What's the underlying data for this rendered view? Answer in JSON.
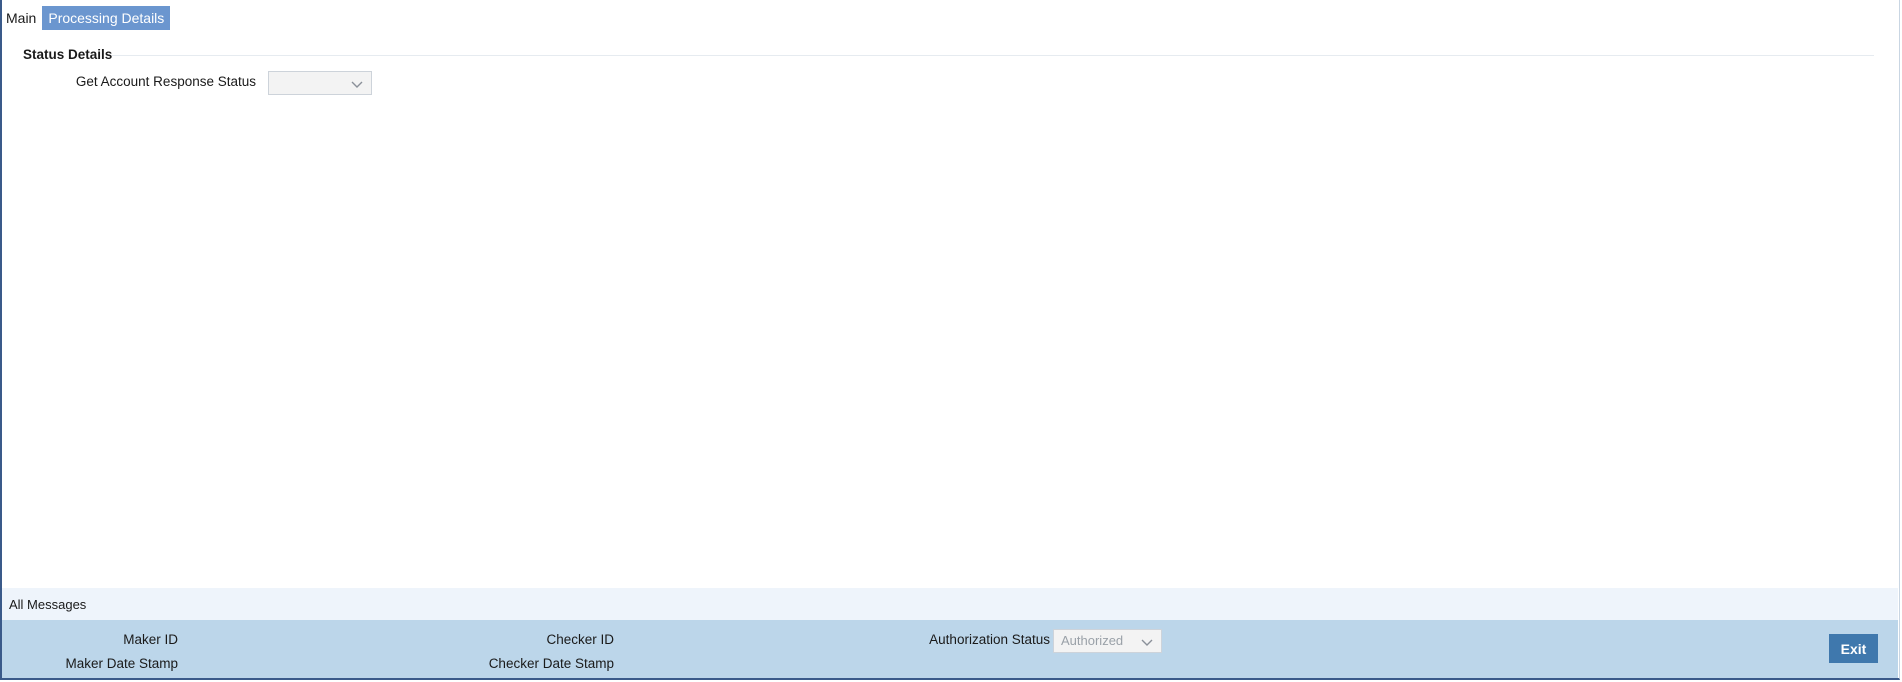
{
  "tabs": [
    {
      "label": "Main",
      "active": false
    },
    {
      "label": "Processing Details",
      "active": true
    }
  ],
  "status_details": {
    "title": "Status Details",
    "get_account_response_status": {
      "label": "Get Account Response Status",
      "value": ""
    }
  },
  "messages": {
    "label": "All Messages"
  },
  "footer": {
    "maker_id_label": "Maker ID",
    "maker_date_stamp_label": "Maker Date Stamp",
    "checker_id_label": "Checker ID",
    "checker_date_stamp_label": "Checker Date Stamp",
    "authorization_status_label": "Authorization Status",
    "authorization_status_value": "Authorized",
    "exit_label": "Exit"
  },
  "icons": [
    "chevron-down-icon"
  ],
  "colors": {
    "active_tab": "#6b96cf",
    "footer_bg": "#bcd6ea",
    "messages_bg": "#eef4fb",
    "exit_button": "#3f78ad"
  }
}
